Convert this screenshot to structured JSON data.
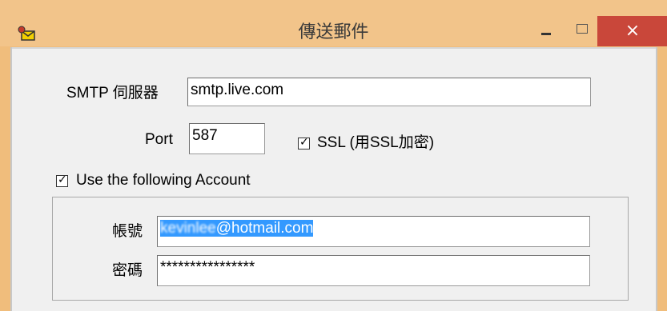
{
  "window": {
    "title": "傳送郵件",
    "close_glyph": "×"
  },
  "smtp": {
    "label": "SMTP 伺服器",
    "value": "smtp.live.com"
  },
  "port": {
    "label": "Port",
    "value": "587"
  },
  "ssl": {
    "label": "SSL (用SSL加密)",
    "checked": true
  },
  "account_toggle": {
    "label": "Use the following Account",
    "checked": true
  },
  "account": {
    "label": "帳號",
    "value_hidden": "kevinlee",
    "value_domain": "@hotmail.com"
  },
  "password": {
    "label": "密碼",
    "value": "****************"
  },
  "colors": {
    "titlebar": "#f2c48a",
    "close_button": "#c9473a",
    "selection": "#3399ff"
  }
}
